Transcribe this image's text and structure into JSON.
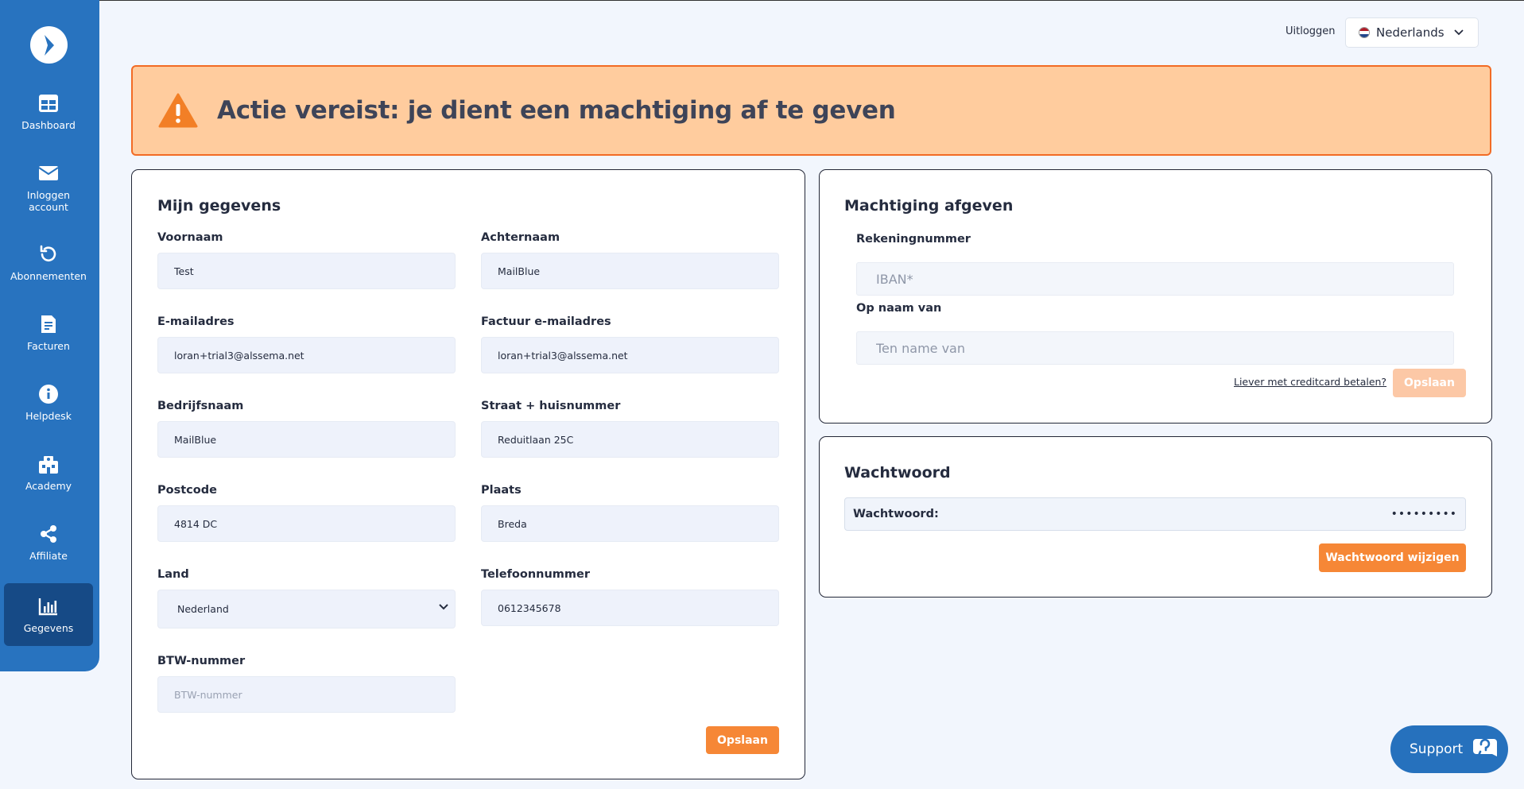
{
  "sidebar": {
    "items": [
      {
        "label": "Dashboard",
        "icon": "dashboard-icon"
      },
      {
        "label": "Inloggen account",
        "icon": "envelope-icon"
      },
      {
        "label": "Abonnementen",
        "icon": "refresh-icon"
      },
      {
        "label": "Facturen",
        "icon": "invoice-icon"
      },
      {
        "label": "Helpdesk",
        "icon": "info-icon"
      },
      {
        "label": "Academy",
        "icon": "academy-icon"
      },
      {
        "label": "Affiliate",
        "icon": "share-icon"
      },
      {
        "label": "Gegevens",
        "icon": "chart-icon",
        "active": true
      }
    ]
  },
  "header": {
    "logout_label": "Uitloggen",
    "language": "Nederlands"
  },
  "alert": {
    "title": "Actie vereist: je dient een machtiging af te geven"
  },
  "details": {
    "title": "Mijn gegevens",
    "fields": {
      "first_name": {
        "label": "Voornaam",
        "value": "Test"
      },
      "last_name": {
        "label": "Achternaam",
        "value": "MailBlue"
      },
      "email": {
        "label": "E-mailadres",
        "value": "loran+trial3@alssema.net"
      },
      "invoice_email": {
        "label": "Factuur e-mailadres",
        "value": "loran+trial3@alssema.net"
      },
      "company": {
        "label": "Bedrijfsnaam",
        "value": "MailBlue"
      },
      "street": {
        "label": "Straat + huisnummer",
        "value": "Reduitlaan 25C"
      },
      "postcode": {
        "label": "Postcode",
        "value": "4814 DC"
      },
      "city": {
        "label": "Plaats",
        "value": "Breda"
      },
      "country": {
        "label": "Land",
        "value": "Nederland"
      },
      "phone": {
        "label": "Telefoonnummer",
        "value": "0612345678"
      },
      "vat": {
        "label": "BTW-nummer",
        "value": "",
        "placeholder": "BTW-nummer"
      }
    },
    "save_label": "Opslaan"
  },
  "mandate": {
    "title": "Machtiging afgeven",
    "account_label": "Rekeningnummer",
    "account_placeholder": "IBAN*",
    "name_label": "Op naam van",
    "name_placeholder": "Ten name van",
    "creditcard_link": "Liever met creditcard betalen?",
    "save_label": "Opslaan"
  },
  "password": {
    "title": "Wachtwoord",
    "label": "Wachtwoord:",
    "masked": "•••••••••",
    "change_label": "Wachtwoord wijzigen"
  },
  "support": {
    "label": "Support"
  },
  "colors": {
    "sidebar": "#2873bf",
    "sidebar_active": "#164a86",
    "accent": "#f68736",
    "alert_bg": "#ffcc9e",
    "alert_border": "#f26b25",
    "warning_icon": "#f27f26"
  }
}
